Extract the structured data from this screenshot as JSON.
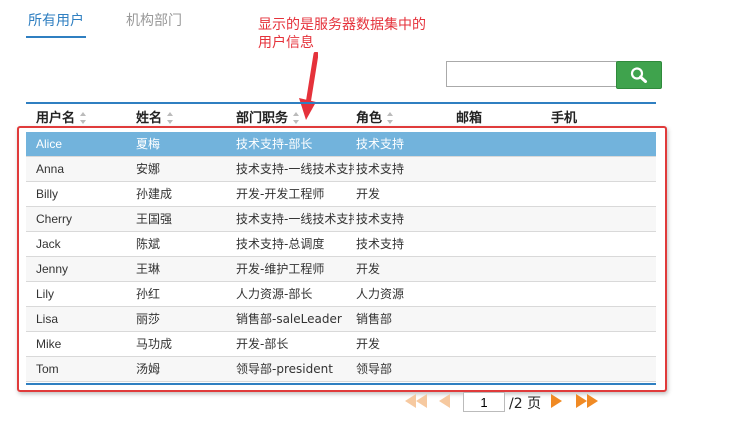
{
  "tabs": [
    {
      "label": "所有用户",
      "active": true
    },
    {
      "label": "机构部门",
      "active": false
    }
  ],
  "annotation": "显示的是服务器数据集中的用户信息",
  "search": {
    "value": "",
    "placeholder": ""
  },
  "columns": [
    "用户名",
    "姓名",
    "部门职务",
    "角色",
    "邮箱",
    "手机"
  ],
  "rows": [
    {
      "username": "Alice",
      "name": "夏梅",
      "dept": "技术支持-部长",
      "role": "技术支持"
    },
    {
      "username": "Anna",
      "name": "安娜",
      "dept": "技术支持-一线技术支持",
      "role": "技术支持"
    },
    {
      "username": "Billy",
      "name": "孙建成",
      "dept": "开发-开发工程师",
      "role": "开发"
    },
    {
      "username": "Cherry",
      "name": "王国强",
      "dept": "技术支持-一线技术支持",
      "role": "技术支持"
    },
    {
      "username": "Jack",
      "name": "陈斌",
      "dept": "技术支持-总调度",
      "role": "技术支持"
    },
    {
      "username": "Jenny",
      "name": "王琳",
      "dept": "开发-维护工程师",
      "role": "开发"
    },
    {
      "username": "Lily",
      "name": "孙红",
      "dept": "人力资源-部长",
      "role": "人力资源"
    },
    {
      "username": "Lisa",
      "name": "丽莎",
      "dept": "销售部-saleLeader",
      "role": "销售部"
    },
    {
      "username": "Mike",
      "name": "马功成",
      "dept": "开发-部长",
      "role": "开发"
    },
    {
      "username": "Tom",
      "name": "汤姆",
      "dept": "领导部-president",
      "role": "领导部"
    }
  ],
  "selected_row": 0,
  "pager": {
    "current_page": "1",
    "total_label": "/2 页"
  },
  "colors": {
    "accent": "#2f7fc1",
    "selected": "#72b3dc",
    "search_button": "#3fa34d",
    "annotation": "#e5323b",
    "pager_arrows": "#f08a24"
  },
  "icons": {
    "search_button": "search-icon",
    "first": "first-page-icon",
    "prev": "prev-page-icon",
    "next": "next-page-icon",
    "last": "last-page-icon"
  }
}
